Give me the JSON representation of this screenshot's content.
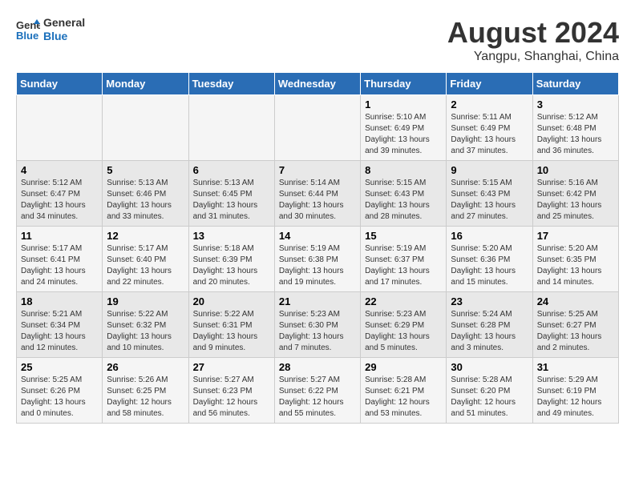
{
  "header": {
    "logo_line1": "General",
    "logo_line2": "Blue",
    "title": "August 2024",
    "subtitle": "Yangpu, Shanghai, China"
  },
  "calendar": {
    "days_of_week": [
      "Sunday",
      "Monday",
      "Tuesday",
      "Wednesday",
      "Thursday",
      "Friday",
      "Saturday"
    ],
    "weeks": [
      [
        {
          "day": "",
          "info": ""
        },
        {
          "day": "",
          "info": ""
        },
        {
          "day": "",
          "info": ""
        },
        {
          "day": "",
          "info": ""
        },
        {
          "day": "1",
          "info": "Sunrise: 5:10 AM\nSunset: 6:49 PM\nDaylight: 13 hours\nand 39 minutes."
        },
        {
          "day": "2",
          "info": "Sunrise: 5:11 AM\nSunset: 6:49 PM\nDaylight: 13 hours\nand 37 minutes."
        },
        {
          "day": "3",
          "info": "Sunrise: 5:12 AM\nSunset: 6:48 PM\nDaylight: 13 hours\nand 36 minutes."
        }
      ],
      [
        {
          "day": "4",
          "info": "Sunrise: 5:12 AM\nSunset: 6:47 PM\nDaylight: 13 hours\nand 34 minutes."
        },
        {
          "day": "5",
          "info": "Sunrise: 5:13 AM\nSunset: 6:46 PM\nDaylight: 13 hours\nand 33 minutes."
        },
        {
          "day": "6",
          "info": "Sunrise: 5:13 AM\nSunset: 6:45 PM\nDaylight: 13 hours\nand 31 minutes."
        },
        {
          "day": "7",
          "info": "Sunrise: 5:14 AM\nSunset: 6:44 PM\nDaylight: 13 hours\nand 30 minutes."
        },
        {
          "day": "8",
          "info": "Sunrise: 5:15 AM\nSunset: 6:43 PM\nDaylight: 13 hours\nand 28 minutes."
        },
        {
          "day": "9",
          "info": "Sunrise: 5:15 AM\nSunset: 6:43 PM\nDaylight: 13 hours\nand 27 minutes."
        },
        {
          "day": "10",
          "info": "Sunrise: 5:16 AM\nSunset: 6:42 PM\nDaylight: 13 hours\nand 25 minutes."
        }
      ],
      [
        {
          "day": "11",
          "info": "Sunrise: 5:17 AM\nSunset: 6:41 PM\nDaylight: 13 hours\nand 24 minutes."
        },
        {
          "day": "12",
          "info": "Sunrise: 5:17 AM\nSunset: 6:40 PM\nDaylight: 13 hours\nand 22 minutes."
        },
        {
          "day": "13",
          "info": "Sunrise: 5:18 AM\nSunset: 6:39 PM\nDaylight: 13 hours\nand 20 minutes."
        },
        {
          "day": "14",
          "info": "Sunrise: 5:19 AM\nSunset: 6:38 PM\nDaylight: 13 hours\nand 19 minutes."
        },
        {
          "day": "15",
          "info": "Sunrise: 5:19 AM\nSunset: 6:37 PM\nDaylight: 13 hours\nand 17 minutes."
        },
        {
          "day": "16",
          "info": "Sunrise: 5:20 AM\nSunset: 6:36 PM\nDaylight: 13 hours\nand 15 minutes."
        },
        {
          "day": "17",
          "info": "Sunrise: 5:20 AM\nSunset: 6:35 PM\nDaylight: 13 hours\nand 14 minutes."
        }
      ],
      [
        {
          "day": "18",
          "info": "Sunrise: 5:21 AM\nSunset: 6:34 PM\nDaylight: 13 hours\nand 12 minutes."
        },
        {
          "day": "19",
          "info": "Sunrise: 5:22 AM\nSunset: 6:32 PM\nDaylight: 13 hours\nand 10 minutes."
        },
        {
          "day": "20",
          "info": "Sunrise: 5:22 AM\nSunset: 6:31 PM\nDaylight: 13 hours\nand 9 minutes."
        },
        {
          "day": "21",
          "info": "Sunrise: 5:23 AM\nSunset: 6:30 PM\nDaylight: 13 hours\nand 7 minutes."
        },
        {
          "day": "22",
          "info": "Sunrise: 5:23 AM\nSunset: 6:29 PM\nDaylight: 13 hours\nand 5 minutes."
        },
        {
          "day": "23",
          "info": "Sunrise: 5:24 AM\nSunset: 6:28 PM\nDaylight: 13 hours\nand 3 minutes."
        },
        {
          "day": "24",
          "info": "Sunrise: 5:25 AM\nSunset: 6:27 PM\nDaylight: 13 hours\nand 2 minutes."
        }
      ],
      [
        {
          "day": "25",
          "info": "Sunrise: 5:25 AM\nSunset: 6:26 PM\nDaylight: 13 hours\nand 0 minutes."
        },
        {
          "day": "26",
          "info": "Sunrise: 5:26 AM\nSunset: 6:25 PM\nDaylight: 12 hours\nand 58 minutes."
        },
        {
          "day": "27",
          "info": "Sunrise: 5:27 AM\nSunset: 6:23 PM\nDaylight: 12 hours\nand 56 minutes."
        },
        {
          "day": "28",
          "info": "Sunrise: 5:27 AM\nSunset: 6:22 PM\nDaylight: 12 hours\nand 55 minutes."
        },
        {
          "day": "29",
          "info": "Sunrise: 5:28 AM\nSunset: 6:21 PM\nDaylight: 12 hours\nand 53 minutes."
        },
        {
          "day": "30",
          "info": "Sunrise: 5:28 AM\nSunset: 6:20 PM\nDaylight: 12 hours\nand 51 minutes."
        },
        {
          "day": "31",
          "info": "Sunrise: 5:29 AM\nSunset: 6:19 PM\nDaylight: 12 hours\nand 49 minutes."
        }
      ]
    ]
  }
}
